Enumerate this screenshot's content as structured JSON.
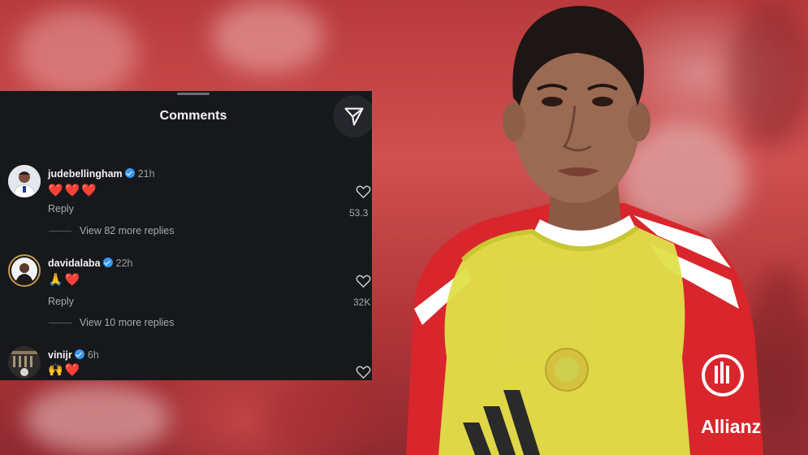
{
  "panel": {
    "title": "Comments",
    "icons": {
      "share": "send-icon",
      "like": "heart-outline-icon",
      "verified": "verified-badge-icon"
    }
  },
  "comments": [
    {
      "username": "judebellingham",
      "time": "21h",
      "text": "❤️❤️❤️",
      "reply_label": "Reply",
      "view_replies": "View 82 more replies",
      "likes": "53.3"
    },
    {
      "username": "davidalaba",
      "time": "22h",
      "text": "🙏❤️",
      "reply_label": "Reply",
      "view_replies": "View 10 more replies",
      "likes": "32K"
    },
    {
      "username": "vinijr",
      "time": "6h",
      "text": "🙌❤️"
    }
  ],
  "photo": {
    "shirt_text": "Allianz",
    "colors": {
      "shirt_red": "#d8262c",
      "bib_yellow": "#dfe04a",
      "panel_bg": "#16181c",
      "verified_blue": "#3897f0"
    }
  }
}
